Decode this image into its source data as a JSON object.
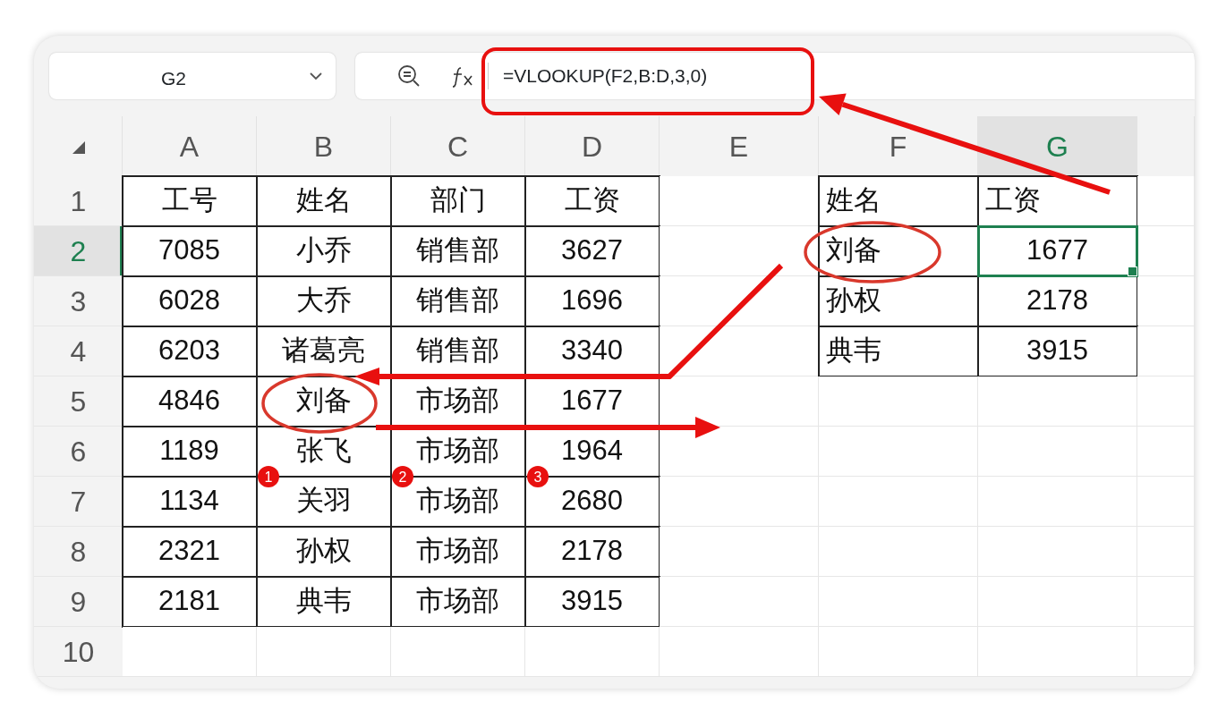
{
  "toolbar": {
    "name_box": "G2",
    "formula": "=VLOOKUP(F2,B:D,3,0)"
  },
  "columns": [
    {
      "label": "A",
      "selected": false
    },
    {
      "label": "B",
      "selected": false
    },
    {
      "label": "C",
      "selected": false
    },
    {
      "label": "D",
      "selected": false
    },
    {
      "label": "E",
      "selected": false
    },
    {
      "label": "F",
      "selected": false
    },
    {
      "label": "G",
      "selected": true
    }
  ],
  "rows": [
    {
      "label": "1",
      "selected": false,
      "cells": [
        {
          "text": "工号"
        },
        {
          "text": "姓名"
        },
        {
          "text": "部门"
        },
        {
          "text": "工资"
        },
        null,
        {
          "text": "姓名",
          "left_aligned": true
        },
        {
          "text": "工资",
          "left_aligned": true
        }
      ]
    },
    {
      "label": "2",
      "selected": true,
      "cells": [
        {
          "text": "7085"
        },
        {
          "text": "小乔"
        },
        {
          "text": "销售部"
        },
        {
          "text": "3627"
        },
        null,
        {
          "text": "刘备",
          "left_aligned": true
        },
        {
          "text": "1677",
          "selected": true
        }
      ]
    },
    {
      "label": "3",
      "selected": false,
      "cells": [
        {
          "text": "6028"
        },
        {
          "text": "大乔"
        },
        {
          "text": "销售部"
        },
        {
          "text": "1696"
        },
        null,
        {
          "text": "孙权",
          "left_aligned": true
        },
        {
          "text": "2178"
        }
      ]
    },
    {
      "label": "4",
      "selected": false,
      "cells": [
        {
          "text": "6203"
        },
        {
          "text": "诸葛亮"
        },
        {
          "text": "销售部"
        },
        {
          "text": "3340"
        },
        null,
        {
          "text": "典韦",
          "left_aligned": true
        },
        {
          "text": "3915"
        }
      ]
    },
    {
      "label": "5",
      "selected": false,
      "cells": [
        {
          "text": "4846"
        },
        {
          "text": "刘备"
        },
        {
          "text": "市场部"
        },
        {
          "text": "1677"
        },
        null,
        null,
        null
      ]
    },
    {
      "label": "6",
      "selected": false,
      "cells": [
        {
          "text": "1189"
        },
        {
          "text": "张飞"
        },
        {
          "text": "市场部"
        },
        {
          "text": "1964"
        },
        null,
        null,
        null
      ]
    },
    {
      "label": "7",
      "selected": false,
      "cells": [
        {
          "text": "1134"
        },
        {
          "text": "关羽"
        },
        {
          "text": "市场部"
        },
        {
          "text": "2680"
        },
        null,
        null,
        null
      ]
    },
    {
      "label": "8",
      "selected": false,
      "cells": [
        {
          "text": "2321"
        },
        {
          "text": "孙权"
        },
        {
          "text": "市场部"
        },
        {
          "text": "2178"
        },
        null,
        null,
        null
      ]
    },
    {
      "label": "9",
      "selected": false,
      "cells": [
        {
          "text": "2181"
        },
        {
          "text": "典韦"
        },
        {
          "text": "市场部"
        },
        {
          "text": "3915"
        },
        null,
        null,
        null
      ]
    },
    {
      "label": "10",
      "selected": false,
      "cells": [
        null,
        null,
        null,
        null,
        null,
        null,
        null
      ]
    }
  ],
  "annotations": {
    "badges": [
      {
        "text": "1"
      },
      {
        "text": "2"
      },
      {
        "text": "3"
      }
    ]
  }
}
